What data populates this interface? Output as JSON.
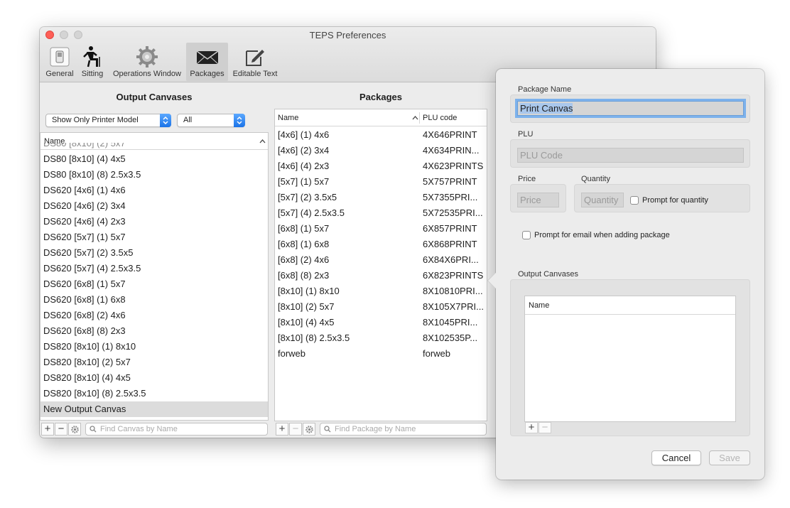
{
  "window": {
    "title": "TEPS Preferences"
  },
  "toolbar": {
    "items": [
      {
        "label": "General",
        "icon": "switch-icon"
      },
      {
        "label": "Sitting",
        "icon": "sitting-person-icon"
      },
      {
        "label": "Operations Window",
        "icon": "gear-icon"
      },
      {
        "label": "Packages",
        "icon": "envelope-icon",
        "selected": true
      },
      {
        "label": "Editable Text",
        "icon": "pencil-edit-icon"
      }
    ]
  },
  "output_canvases": {
    "title": "Output Canvases",
    "filter_label": "Show Only Printer Model",
    "model_label": "All",
    "column_name": "Name",
    "partial_row": "DS80 [8x10] (2) 5x7",
    "rows": [
      "DS80 [8x10] (4) 4x5",
      "DS80 [8x10] (8) 2.5x3.5",
      "DS620 [4x6] (1) 4x6",
      "DS620 [4x6] (2) 3x4",
      "DS620 [4x6] (4) 2x3",
      "DS620 [5x7] (1) 5x7",
      "DS620 [5x7] (2) 3.5x5",
      "DS620 [5x7] (4) 2.5x3.5",
      "DS620 [6x8] (1) 5x7",
      "DS620 [6x8] (1) 6x8",
      "DS620 [6x8] (2) 4x6",
      "DS620 [6x8] (8) 2x3",
      "DS820 [8x10] (1) 8x10",
      "DS820 [8x10] (2) 5x7",
      "DS820 [8x10] (4) 4x5",
      "DS820 [8x10] (8) 2.5x3.5",
      "New Output Canvas"
    ],
    "search_placeholder": "Find Canvas by Name"
  },
  "packages": {
    "title": "Packages",
    "col_name": "Name",
    "col_plu": "PLU code",
    "rows": [
      {
        "name": "[4x6] (1) 4x6",
        "plu": "4X646PRINT"
      },
      {
        "name": "[4x6] (2) 3x4",
        "plu": "4X634PRIN..."
      },
      {
        "name": "[4x6] (4) 2x3",
        "plu": "4X623PRINTS"
      },
      {
        "name": "[5x7] (1) 5x7",
        "plu": "5X757PRINT"
      },
      {
        "name": "[5x7] (2) 3.5x5",
        "plu": "5X7355PRI..."
      },
      {
        "name": "[5x7] (4) 2.5x3.5",
        "plu": "5X72535PRI..."
      },
      {
        "name": "[6x8] (1) 5x7",
        "plu": "6X857PRINT"
      },
      {
        "name": "[6x8] (1) 6x8",
        "plu": "6X868PRINT"
      },
      {
        "name": "[6x8] (2) 4x6",
        "plu": "6X84X6PRI..."
      },
      {
        "name": "[6x8] (8) 2x3",
        "plu": "6X823PRINTS"
      },
      {
        "name": "[8x10] (1) 8x10",
        "plu": "8X10810PRI..."
      },
      {
        "name": "[8x10] (2) 5x7",
        "plu": "8X105X7PRI..."
      },
      {
        "name": "[8x10] (4) 4x5",
        "plu": "8X1045PRI..."
      },
      {
        "name": "[8x10] (8) 2.5x3.5",
        "plu": "8X102535P..."
      },
      {
        "name": "forweb",
        "plu": "forweb"
      }
    ],
    "search_placeholder": "Find Package by Name"
  },
  "editor": {
    "package_name_label": "Package Name",
    "package_name_value": "Print Canvas",
    "plu_label": "PLU",
    "plu_placeholder": "PLU Code",
    "price_label": "Price",
    "price_placeholder": "Price",
    "quantity_label": "Quantity",
    "quantity_placeholder": "Quantity",
    "prompt_quantity_label": "Prompt for quantity",
    "prompt_email_label": "Prompt for email when adding package",
    "output_canvases_label": "Output Canvases",
    "canvas_column": "Name",
    "cancel_label": "Cancel",
    "save_label": "Save"
  }
}
